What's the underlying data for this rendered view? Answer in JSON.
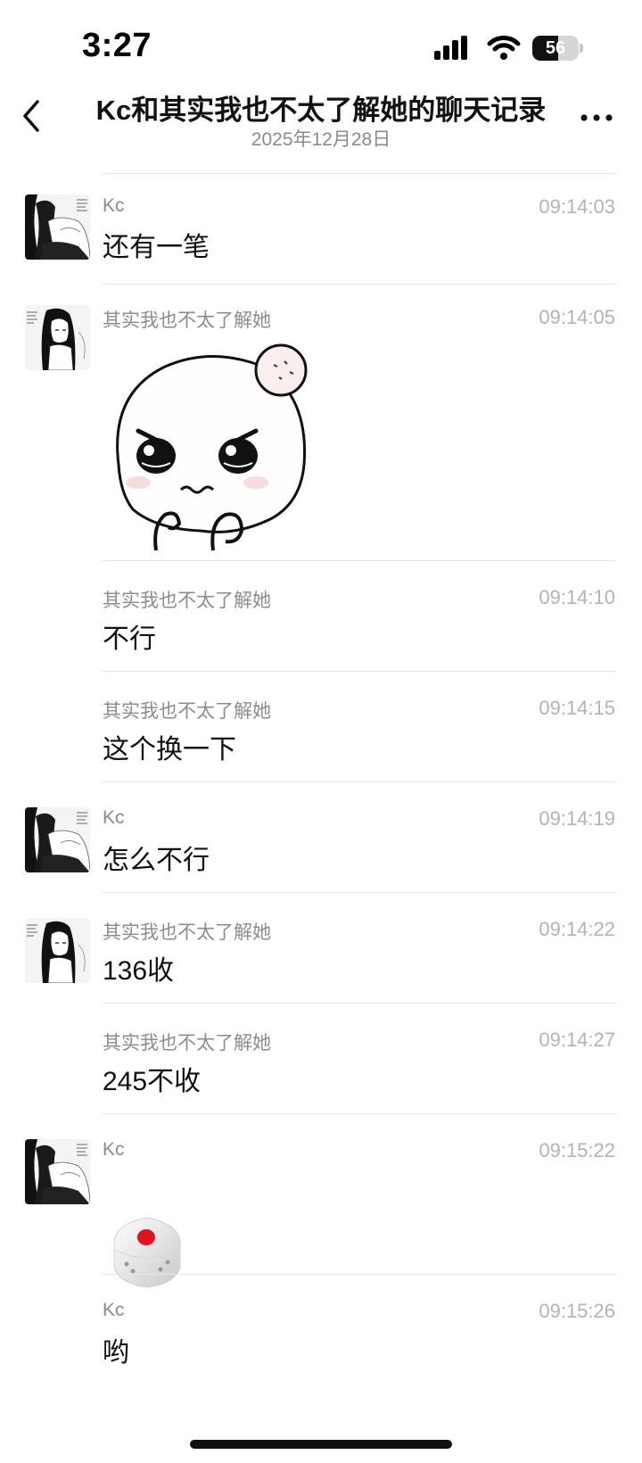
{
  "status_bar": {
    "time": "3:27",
    "battery": "56",
    "battery_level": 0.56,
    "signal_icon": "cellular-signal-icon",
    "wifi_icon": "wifi-icon"
  },
  "header": {
    "title": "Kc和其实我也不太了解她的聊天记录",
    "date": "2025年12月28日",
    "back_icon": "chevron-left-icon",
    "more_icon": "more-horizontal-icon"
  },
  "messages": [
    {
      "sender": "Kc",
      "time": "09:14:03",
      "text": "还有一笔"
    },
    {
      "sender": "其实我也不太了解她",
      "time": "09:14:05",
      "type": "sticker",
      "sticker": "angry-crying-mochi-sticker"
    },
    {
      "sender": "其实我也不太了解她",
      "time": "09:14:10",
      "text": "不行"
    },
    {
      "sender": "其实我也不太了解她",
      "time": "09:14:15",
      "text": "这个换一下"
    },
    {
      "sender": "Kc",
      "time": "09:14:19",
      "text": "怎么不行"
    },
    {
      "sender": "其实我也不太了解她",
      "time": "09:14:22",
      "text": "136收"
    },
    {
      "sender": "其实我也不太了解她",
      "time": "09:14:27",
      "text": "245不收"
    },
    {
      "sender": "Kc",
      "time": "09:15:22",
      "type": "dice",
      "dice_value": 1
    },
    {
      "sender": "Kc",
      "time": "09:15:26",
      "text": "哟"
    }
  ],
  "colors": {
    "text": "#111111",
    "secondary_text": "#8c8c8c",
    "timestamp": "#b3b3b3",
    "divider": "#e6e6e6",
    "dice_pip": "#e0141e"
  }
}
